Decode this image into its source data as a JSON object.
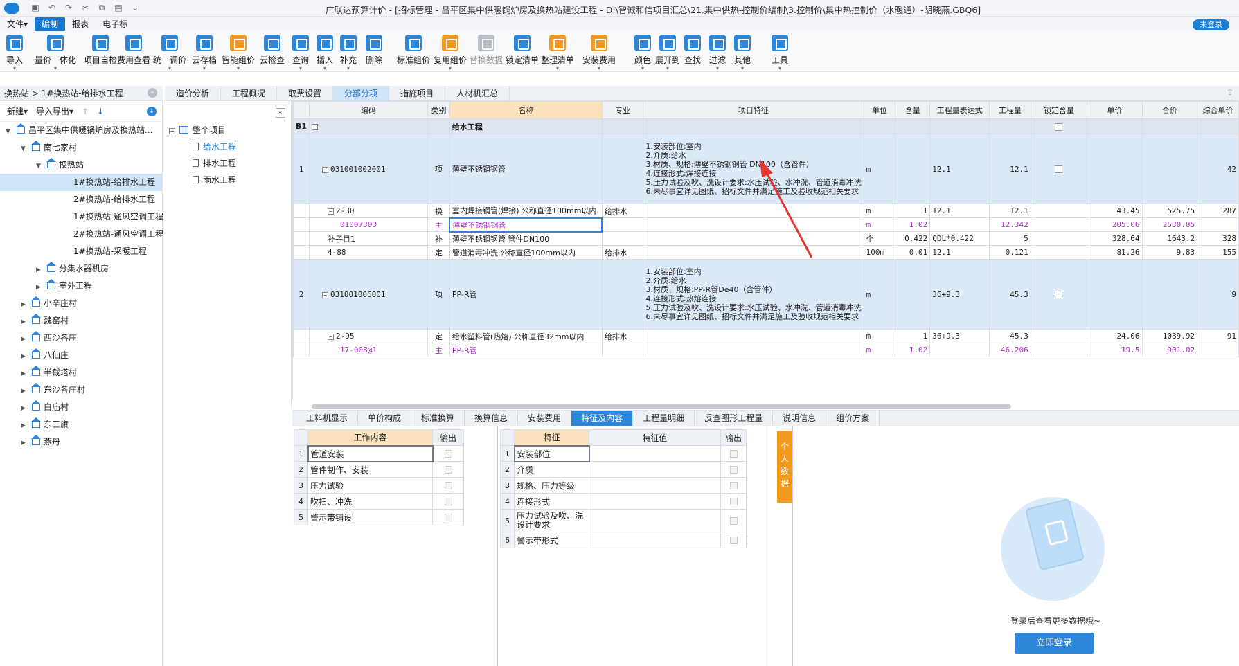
{
  "app": {
    "title": "广联达预算计价 - [招标管理 - 昌平区集中供暖锅炉房及换热站建设工程 - D:\\智诚和信项目汇总\\21.集中供热-控制价编制\\3.控制价\\集中热控制价（水暖通）-胡晓燕.GBQ6]",
    "login_status": "未登录",
    "accent": "#2d86d9",
    "highlight": "#f29a1f"
  },
  "menu": [
    "文件▾",
    "编制",
    "报表",
    "电子标"
  ],
  "toolbar": [
    {
      "label": "导入",
      "icon": "import-icon",
      "dd": true
    },
    {
      "label": "量价一体化",
      "icon": "integrate-icon",
      "dd": true
    },
    {
      "label": "项目自检",
      "icon": "check-icon"
    },
    {
      "label": "费用查看",
      "icon": "fee-view-icon"
    },
    {
      "label": "统一调价",
      "icon": "adjust-price-icon",
      "dd": true
    },
    {
      "label": "云存档",
      "icon": "cloud-save-icon",
      "dd": true
    },
    {
      "label": "智能组价",
      "icon": "smart-price-icon",
      "dd": true
    },
    {
      "label": "云检查",
      "icon": "cloud-check-icon"
    },
    {
      "label": "查询",
      "icon": "query-icon",
      "dd": true
    },
    {
      "label": "插入",
      "icon": "insert-icon",
      "dd": true
    },
    {
      "label": "补充",
      "icon": "supplement-icon",
      "dd": true
    },
    {
      "label": "删除",
      "icon": "delete-icon"
    },
    {
      "label": "标准组价",
      "icon": "standard-price-icon"
    },
    {
      "label": "复用组价",
      "icon": "reuse-price-icon",
      "dd": true
    },
    {
      "label": "替换数据",
      "icon": "replace-data-icon",
      "disabled": true
    },
    {
      "label": "锁定清单",
      "icon": "lock-list-icon"
    },
    {
      "label": "整理清单",
      "icon": "organize-list-icon",
      "dd": true
    },
    {
      "label": "安装费用",
      "icon": "install-fee-icon",
      "dd": true
    },
    {
      "label": "颜色",
      "icon": "color-icon",
      "dd": true
    },
    {
      "label": "展开到",
      "icon": "expand-to-icon",
      "dd": true
    },
    {
      "label": "查找",
      "icon": "find-icon"
    },
    {
      "label": "过滤",
      "icon": "filter-icon",
      "dd": true
    },
    {
      "label": "其他",
      "icon": "other-icon",
      "dd": true
    },
    {
      "label": "工具",
      "icon": "tools-icon",
      "dd": true
    }
  ],
  "breadcrumb": "换热站 > 1#换热站-给排水工程",
  "tabs": [
    "造价分析",
    "工程概况",
    "取费设置",
    "分部分项",
    "措施项目",
    "人材机汇总"
  ],
  "left_tools": {
    "new": "新建▾",
    "import_export": "导入导出▾"
  },
  "project_tree": [
    {
      "label": "昌平区集中供暖锅炉房及换热站...",
      "level": 0,
      "toggle": "▼",
      "icon": "building"
    },
    {
      "label": "南七家村",
      "level": 1,
      "toggle": "▼",
      "icon": "home"
    },
    {
      "label": "换热站",
      "level": 2,
      "toggle": "▼",
      "icon": "home"
    },
    {
      "label": "1#换热站-给排水工程",
      "level": 3,
      "selected": true
    },
    {
      "label": "2#换热站-给排水工程",
      "level": 3
    },
    {
      "label": "1#换热站-通风空调工程",
      "level": 3
    },
    {
      "label": "2#换热站-通风空调工程",
      "level": 3
    },
    {
      "label": "1#换热站-采暖工程",
      "level": 3
    },
    {
      "label": "分集水器机房",
      "level": 2,
      "toggle": "▶",
      "icon": "home"
    },
    {
      "label": "室外工程",
      "level": 2,
      "toggle": "▶",
      "icon": "home"
    },
    {
      "label": "小辛庄村",
      "level": 1,
      "toggle": "▶",
      "icon": "home"
    },
    {
      "label": "魏窑村",
      "level": 1,
      "toggle": "▶",
      "icon": "home"
    },
    {
      "label": "西沙各庄",
      "level": 1,
      "toggle": "▶",
      "icon": "home"
    },
    {
      "label": "八仙庄",
      "level": 1,
      "toggle": "▶",
      "icon": "home"
    },
    {
      "label": "半截塔村",
      "level": 1,
      "toggle": "▶",
      "icon": "home"
    },
    {
      "label": "东沙各庄村",
      "level": 1,
      "toggle": "▶",
      "icon": "home"
    },
    {
      "label": "白庙村",
      "level": 1,
      "toggle": "▶",
      "icon": "home"
    },
    {
      "label": "东三旗",
      "level": 1,
      "toggle": "▶",
      "icon": "home"
    },
    {
      "label": "燕丹",
      "level": 1,
      "toggle": "▶",
      "icon": "home"
    }
  ],
  "section_tree": [
    {
      "label": "整个项目",
      "type": "root"
    },
    {
      "label": "给水工程",
      "type": "doc",
      "selected": true
    },
    {
      "label": "排水工程",
      "type": "doc"
    },
    {
      "label": "雨水工程",
      "type": "doc"
    }
  ],
  "grid": {
    "headers": [
      "编码",
      "类别",
      "名称",
      "专业",
      "项目特征",
      "单位",
      "含量",
      "工程量表达式",
      "工程量",
      "锁定含量",
      "单价",
      "合价",
      "综合单价"
    ],
    "b1": {
      "idx": "B1",
      "name": "给水工程"
    },
    "rows": [
      {
        "kind": "qd",
        "idx": "1",
        "code": "031001002001",
        "cat": "项",
        "name": "薄壁不锈钢钢管",
        "major": "",
        "feature": [
          "1.安装部位:室内",
          "2.介质:给水",
          "3.材质、规格:薄壁不锈钢钢管 DN100（含管件）",
          "4.连接形式:焊接连接",
          "5.压力试验及吹、洗设计要求:水压试验、水冲洗、管道消毒冲洗",
          "6.未尽事宜详见图纸、招标文件并满足施工及验收规范相关要求"
        ],
        "unit": "m",
        "content": "",
        "expr": "12.1",
        "qty": "12.1",
        "lock": true,
        "price": "",
        "total": "",
        "comp": "42"
      },
      {
        "kind": "de",
        "idx": "",
        "code": "2-30",
        "cat": "换",
        "name": "室内焊接钢管(焊接) 公称直径100mm以内",
        "major": "给排水",
        "feature": [],
        "unit": "m",
        "content": "1",
        "expr": "12.1",
        "qty": "12.1",
        "price": "43.45",
        "total": "525.75",
        "comp": "287"
      },
      {
        "kind": "mat",
        "idx": "",
        "code": "01007303",
        "cat": "主",
        "name": "薄壁不锈钢钢管",
        "major": "",
        "feature": [],
        "unit": "m",
        "content": "1.02",
        "expr": "",
        "qty": "12.342",
        "price": "205.06",
        "total": "2530.85",
        "comp": "",
        "editing": true
      },
      {
        "kind": "de",
        "idx": "",
        "code": "补子目1",
        "cat": "补",
        "name": "薄壁不锈钢钢管 管件DN100",
        "major": "",
        "feature": [],
        "unit": "个",
        "content": "0.422",
        "expr": "QDL*0.422",
        "qty": "5",
        "price": "328.64",
        "total": "1643.2",
        "comp": "328"
      },
      {
        "kind": "de",
        "idx": "",
        "code": "4-88",
        "cat": "定",
        "name": "管道消毒冲洗 公称直径100mm以内",
        "major": "给排水",
        "feature": [],
        "unit": "100m",
        "content": "0.01",
        "expr": "12.1",
        "qty": "0.121",
        "price": "81.26",
        "total": "9.83",
        "comp": "155"
      },
      {
        "kind": "qd",
        "idx": "2",
        "code": "031001006001",
        "cat": "项",
        "name": "PP-R管",
        "major": "",
        "feature": [
          "1.安装部位:室内",
          "2.介质:给水",
          "3.材质、规格:PP-R管De40（含管件）",
          "4.连接形式:热熔连接",
          "5.压力试验及吹、洗设计要求:水压试验、水冲洗、管道消毒冲洗",
          "6.未尽事宜详见图纸、招标文件并满足施工及验收规范相关要求"
        ],
        "unit": "m",
        "content": "",
        "expr": "36+9.3",
        "qty": "45.3",
        "lock": true,
        "price": "",
        "total": "",
        "comp": "9"
      },
      {
        "kind": "de",
        "idx": "",
        "code": "2-95",
        "cat": "定",
        "name": "给水塑料管(热熔) 公称直径32mm以内",
        "major": "给排水",
        "feature": [],
        "unit": "m",
        "content": "1",
        "expr": "36+9.3",
        "qty": "45.3",
        "price": "24.06",
        "total": "1089.92",
        "comp": "91"
      },
      {
        "kind": "mat",
        "idx": "",
        "code": "17-008@1",
        "cat": "主",
        "name": "PP-R管",
        "major": "",
        "feature": [],
        "unit": "m",
        "content": "1.02",
        "expr": "",
        "qty": "46.206",
        "price": "19.5",
        "total": "901.02",
        "comp": ""
      }
    ]
  },
  "bottom_tabs": [
    "工料机显示",
    "单价构成",
    "标准换算",
    "换算信息",
    "安装费用",
    "特征及内容",
    "工程量明细",
    "反查图形工程量",
    "说明信息",
    "组价方案"
  ],
  "work_table": {
    "headers": [
      "工作内容",
      "输出"
    ],
    "rows": [
      "管道安装",
      "管件制作、安装",
      "压力试验",
      "吹扫、冲洗",
      "警示带铺设"
    ]
  },
  "feature_table": {
    "headers": [
      "特征",
      "特征值",
      "输出"
    ],
    "rows": [
      "安装部位",
      "介质",
      "规格、压力等级",
      "连接形式",
      "压力试验及吹、洗设计要求",
      "警示带形式"
    ]
  },
  "personal_strip": "个人数据",
  "login_panel": {
    "tip": "登录后查看更多数据哦~",
    "button": "立即登录"
  }
}
